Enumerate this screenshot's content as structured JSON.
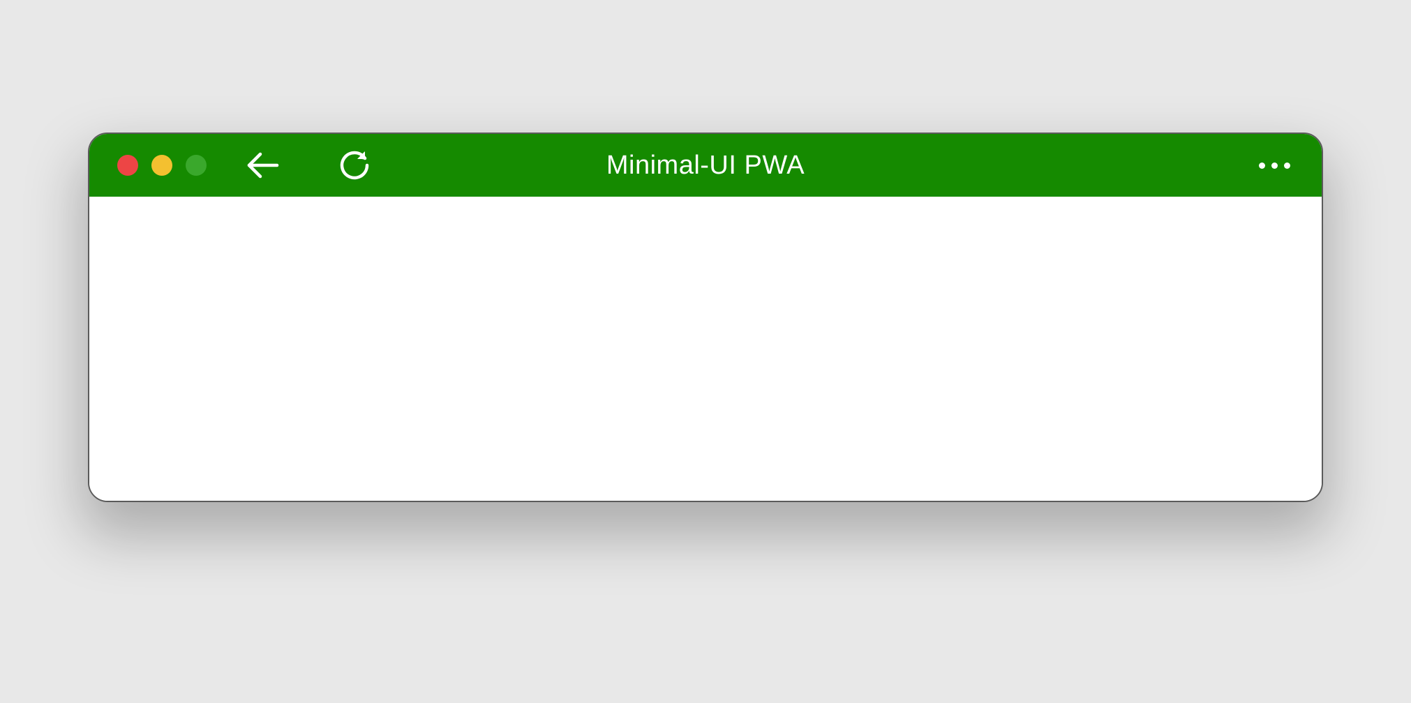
{
  "window": {
    "title": "Minimal-UI PWA"
  },
  "colors": {
    "titlebar": "#158a00",
    "background": "#e8e8e8",
    "content": "#ffffff",
    "traffic_close": "#ed4545",
    "traffic_min": "#f4c030",
    "traffic_max": "#3aa82c"
  },
  "icons": {
    "back": "back-arrow-icon",
    "reload": "reload-icon",
    "menu": "more-options-icon",
    "close": "close-window-icon",
    "minimize": "minimize-window-icon",
    "maximize": "maximize-window-icon"
  }
}
